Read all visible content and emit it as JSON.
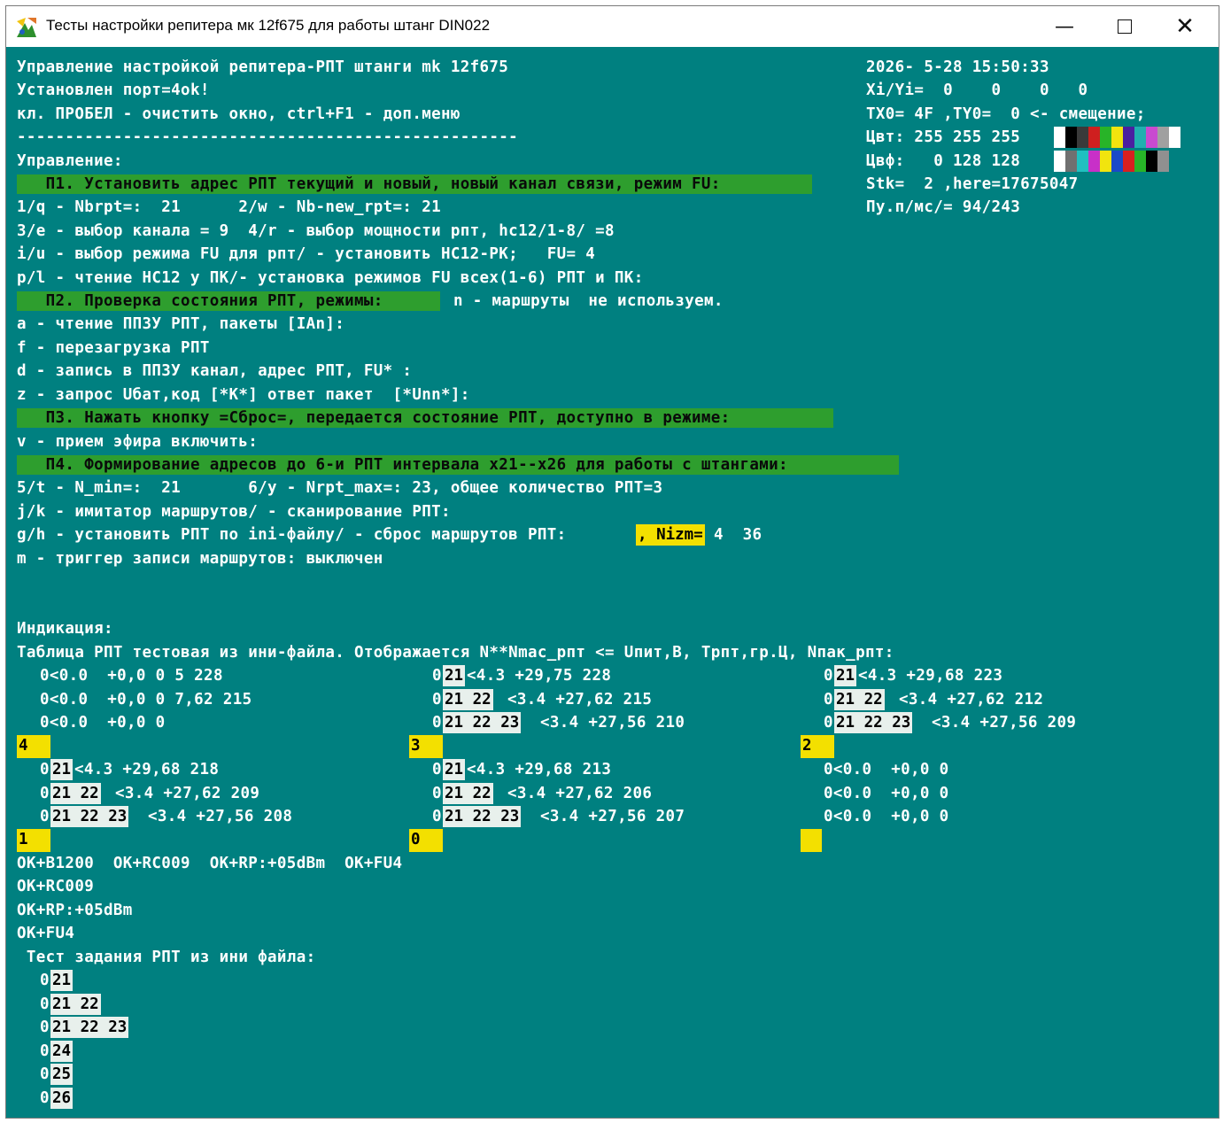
{
  "window": {
    "title": "Тесты настройки репитера мк 12f675 для работы штанг DIN022",
    "icon": "app-icon",
    "minimize_icon": "minimize-icon",
    "maximize_icon": "maximize-icon",
    "close_icon": "close-icon",
    "console_bg": "#008080"
  },
  "header": {
    "line1": "Управление настройкой репитера-РПТ штанги mk 12f675",
    "line2": "Установлен порт=4ok!",
    "line3": "кл. ПРОБЕЛ - очистить окно, ctrl+F1 - доп.меню",
    "divider": "----------------------------------------------------"
  },
  "status": {
    "datetime": "2026- 5-28 15:50:33",
    "xiyi": "Xi/Yi=  0    0    0   0",
    "offset": "TX0= 4F ,TY0=  0 <- смещение;",
    "color_fg": "Цвт: 255 255 255",
    "color_bg": "Цвф:   0 128 128",
    "stack": "Stk=  2 ,here=17675047",
    "pu": "Пу.п/мс/= 94/243"
  },
  "palette": {
    "row1": [
      "#ffffff",
      "#000000",
      "#3a3a3a",
      "#cf1f1f",
      "#28b428",
      "#f1e40e",
      "#4a20a0",
      "#20b0b0",
      "#c84ad0",
      "#a0a0a0",
      "#ffffff"
    ],
    "row2": [
      "#ffffff",
      "#707070",
      "#20c0c0",
      "#c830c8",
      "#f1e40e",
      "#1a4ac8",
      "#d82020",
      "#28b428",
      "#000000",
      "#909090"
    ]
  },
  "control": {
    "heading": "Управление:",
    "p1": "   П1. Установить адрес РПТ текущий и новый, новый канал связи, режим FU:",
    "l1": "1/q - Nbrpt=:  21      2/w - Nb-new_rpt=: 21",
    "l2": "3/e - выбор канала = 9  4/r - выбор мощности рпт, hc12/1-8/ =8",
    "l3": "i/u - выбор режима FU для рпт/ - установить HC12-РК;   FU= 4",
    "l4": "p/l - чтение HC12 у ПК/- установка режимов FU всех(1-6) РПТ и ПК:",
    "p2": "   П2. Проверка состояния РПТ, режимы: ",
    "p2_tail": "n - маршруты  не используем.",
    "l5": "a - чтение ППЗУ РПТ, пакеты [IAn]:",
    "l6": "f - перезагрузка РПТ",
    "l7": "d - запись в ППЗУ канал, адрес РПТ, FU* :",
    "l8": "z - запрос Uбат,код [*K*] ответ пакет  [*Unn*]:",
    "p3": "   П3. Нажать кнопку =Сброс=, передается состояние РПТ, доступно в режиме:",
    "l9": "v - прием эфира включить:",
    "p4": "   П4. Формирование адресов до 6-и РПТ интервала x21--x26 для работы с штангами:",
    "l10": "5/t - N_min=:  21       6/y - Nrpt_max=: 23, общее количество РПТ=3",
    "l11": "j/k - имитатор маршрутов/ - сканирование РПТ:",
    "l12": "g/h - установить РПТ по ini-файлу/ - сброс маршрутов РПТ:",
    "l12_highlight": ", Nizm=",
    "l12_tail": "4  36",
    "l13": "m - триггер записи маршрутов: выключен"
  },
  "indication": {
    "heading": "Индикация:",
    "table_title": "Таблица РПТ тестовая из ини-файла. Отображается N**Nmac_рпт <= Uпит,В, Трпт,гр.Ц, Nпак_рпт:",
    "b_r1c0": "0<0.0  +0,0 0 5 228",
    "b_r2c0": "0<0.0  +0,0 0 7,62 215",
    "b_r3c0": "0<0.0  +0,0 0",
    "b_t1": "21",
    "b_r1c1": "<4.3 +29,75 228",
    "b_t2": "21 22",
    "b_r2c1": "<3.4 +27,62 215",
    "b_t3": "21 22 23",
    "b_r3c1": "<3.4 +27,56 210",
    "b_r1c2": "<4.3 +29,68 223",
    "b_r2c2": "<3.4 +27,62 212",
    "b_r3c2": "<3.4 +27,56 209",
    "lead0": "0",
    "lbl4": "4",
    "lbl3": "3",
    "lbl2": "2",
    "c_r1c0": "<4.3 +29,68 218",
    "c_r2c0": "<3.4 +27,62 209",
    "c_r3c0": "<3.4 +27,56 208",
    "c_r1c1": "<4.3 +29,68 213",
    "c_r2c1": "<3.4 +27,62 206",
    "c_r3c1": "<3.4 +27,56 207",
    "c_r1c2": "0<0.0  +0,0 0",
    "c_r2c2": "0<0.0  +0,0 0",
    "c_r3c2": "0<0.0  +0,0 0",
    "lbl1": "1",
    "lbl0": "0"
  },
  "hc12": {
    "l1": "OK+B1200  OK+RC009  OK+RP:+05dBm  OK+FU4",
    "l2": "OK+RC009",
    "l3": "OK+RP:+05dBm",
    "l4": "OK+FU4"
  },
  "test": {
    "heading": " Тест задания РПТ из ини файла:",
    "r1": "21",
    "r2": "21 22",
    "r3": "21 22 23",
    "r4": "24",
    "r5": "25",
    "r6": "26"
  }
}
